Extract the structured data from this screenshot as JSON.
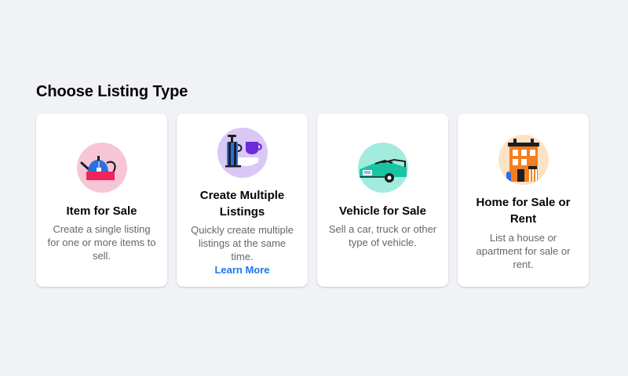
{
  "header": {
    "title": "Choose Listing Type"
  },
  "cards": [
    {
      "title": "Item for Sale",
      "description": "Create a single listing for one or more items to sell.",
      "icon": "teapot-icon",
      "accent": "#f7c6d6"
    },
    {
      "title": "Create Multiple Listings",
      "description": "Quickly create multiple listings at the same time.",
      "link": "Learn More",
      "icon": "coffee-press-icon",
      "accent": "#d9c8f5"
    },
    {
      "title": "Vehicle for Sale",
      "description": "Sell a car, truck or other type of vehicle.",
      "icon": "car-icon",
      "accent": "#a3ecdd"
    },
    {
      "title": "Home for Sale or Rent",
      "description": "List a house or apartment for sale or rent.",
      "icon": "house-icon",
      "accent": "#fde3c4"
    }
  ],
  "colors": {
    "background": "#f0f2f5",
    "link": "#1877f2",
    "secondary_text": "#65676b"
  }
}
